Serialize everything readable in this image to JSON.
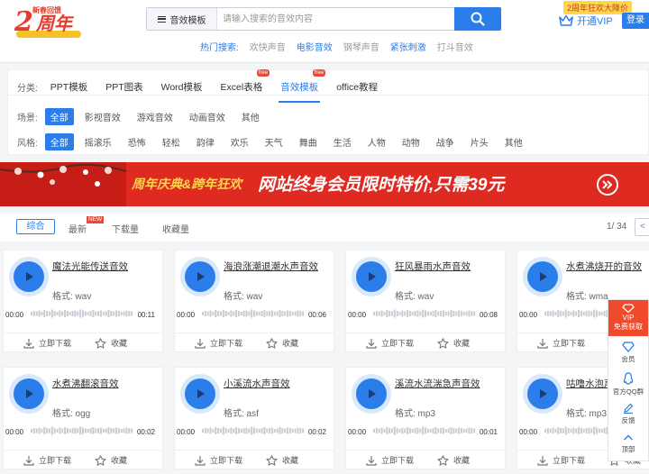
{
  "header": {
    "logo": {
      "badge": "新春回馈",
      "num": "2",
      "word": "周年"
    },
    "search": {
      "category": "音效模板",
      "placeholder": "请输入搜索的音效内容"
    },
    "hot": {
      "label": "热门搜索:",
      "items": [
        "欢快声音",
        "电影音效",
        "钢琴声音",
        "紧张刺激",
        "打斗音效"
      ]
    },
    "promo": "2周年狂欢大降价",
    "vip_label": "开通VIP",
    "login_label": "登录"
  },
  "filters": {
    "category_label": "分类:",
    "categories": [
      "PPT模板",
      "PPT图表",
      "Word模板",
      "Excel表格",
      "音效模板",
      "office教程"
    ],
    "free_tag": "free",
    "scene_label": "场景:",
    "scenes": [
      "全部",
      "影视音效",
      "游戏音效",
      "动画音效",
      "其他"
    ],
    "style_label": "风格:",
    "styles": [
      "全部",
      "摇滚乐",
      "恐怖",
      "轻松",
      "韵律",
      "欢乐",
      "天气",
      "舞曲",
      "生活",
      "人物",
      "动物",
      "战争",
      "片头",
      "其他"
    ]
  },
  "banner": {
    "left": "周年庆典&跨年狂欢",
    "right": "网站终身会员限时特价,只需39元"
  },
  "sort": {
    "items": [
      "综合",
      "最新",
      "下载量",
      "收藏量"
    ],
    "new_tag": "NEW",
    "page": "1/ 34",
    "prev": "<"
  },
  "cards": [
    {
      "title": "魔法光能传送音效",
      "format": "格式: wav",
      "start": "00:00",
      "end": "00:11"
    },
    {
      "title": "海浪涨潮退潮水声音效",
      "format": "格式: wav",
      "start": "00:00",
      "end": "00:06"
    },
    {
      "title": "狂风暴雨水声音效",
      "format": "格式: wav",
      "start": "00:00",
      "end": "00:08"
    },
    {
      "title": "水煮沸烧开的音效",
      "format": "格式: wma",
      "start": "00:00",
      "end": "00:0"
    },
    {
      "title": "水煮沸翻滚音效",
      "format": "格式: ogg",
      "start": "00:00",
      "end": "00:02"
    },
    {
      "title": "小溪流水声音效",
      "format": "格式: asf",
      "start": "00:00",
      "end": "00:02"
    },
    {
      "title": "溪流水流湍急声音效",
      "format": "格式: mp3",
      "start": "00:00",
      "end": "00:01"
    },
    {
      "title": "咕噜水泡声",
      "format": "格式: mp3",
      "start": "00:00",
      "end": "00:0"
    }
  ],
  "card_actions": {
    "download": "立即下载",
    "favorite": "收藏"
  },
  "sidebar": {
    "vip": "VIP",
    "vip_sub": "免费获取",
    "member": "会员",
    "qq": "官方QQ群",
    "feedback": "反馈",
    "top": "顶部"
  }
}
